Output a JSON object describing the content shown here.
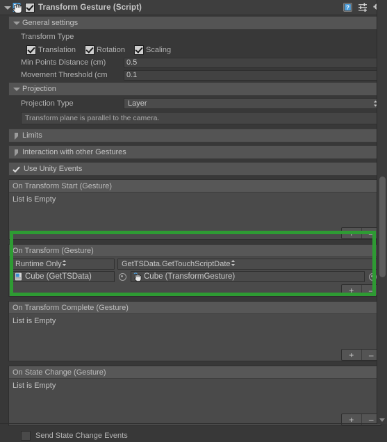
{
  "header": {
    "title": "Transform Gesture (Script)",
    "enabled_checkbox": "checked",
    "icons": [
      "help-icon",
      "preset-icon",
      "gear-icon"
    ]
  },
  "general": {
    "section_label": "General settings",
    "transform_type_label": "Transform Type",
    "toggles": [
      {
        "label": "Translation",
        "checked": true
      },
      {
        "label": "Rotation",
        "checked": true
      },
      {
        "label": "Scaling",
        "checked": true
      }
    ],
    "min_points_distance_label": "Min Points Distance (cm)",
    "min_points_distance_value": "0.5",
    "movement_threshold_label": "Movement Threshold (cm",
    "movement_threshold_value": "0.1"
  },
  "projection": {
    "section_label": "Projection",
    "type_label": "Projection Type",
    "type_value": "Layer",
    "help_text": "Transform plane is parallel to the camera."
  },
  "collapsed_sections": [
    {
      "label": "Limits"
    },
    {
      "label": "Interaction with other Gestures"
    }
  ],
  "use_unity_events": {
    "label": "Use Unity Events",
    "checked": true
  },
  "events": [
    {
      "title": "On Transform Start (Gesture)",
      "empty_text": "List is Empty",
      "entries": [],
      "add_label": "+",
      "remove_label": "–"
    },
    {
      "title": "On Transform (Gesture)",
      "empty_text": "",
      "highlighted": true,
      "entries": [
        {
          "call_state": "Runtime Only",
          "method": "GetTSData.GetTouchScriptDate",
          "target_object": "Cube (GetTSData)",
          "argument_object": "Cube (TransformGesture)"
        }
      ],
      "add_label": "+",
      "remove_label": "–"
    },
    {
      "title": "On Transform Complete (Gesture)",
      "empty_text": "List is Empty",
      "entries": [],
      "add_label": "+",
      "remove_label": "–"
    },
    {
      "title": "On State Change (Gesture)",
      "empty_text": "List is Empty",
      "entries": [],
      "add_label": "+",
      "remove_label": "–"
    }
  ],
  "send_state_change": {
    "label": "Send State Change Events",
    "checked": false
  },
  "colors": {
    "highlight": "#2e9b33",
    "panel_bg": "#383838",
    "header_bg": "#3e3e3e",
    "section_bg": "#545454"
  }
}
